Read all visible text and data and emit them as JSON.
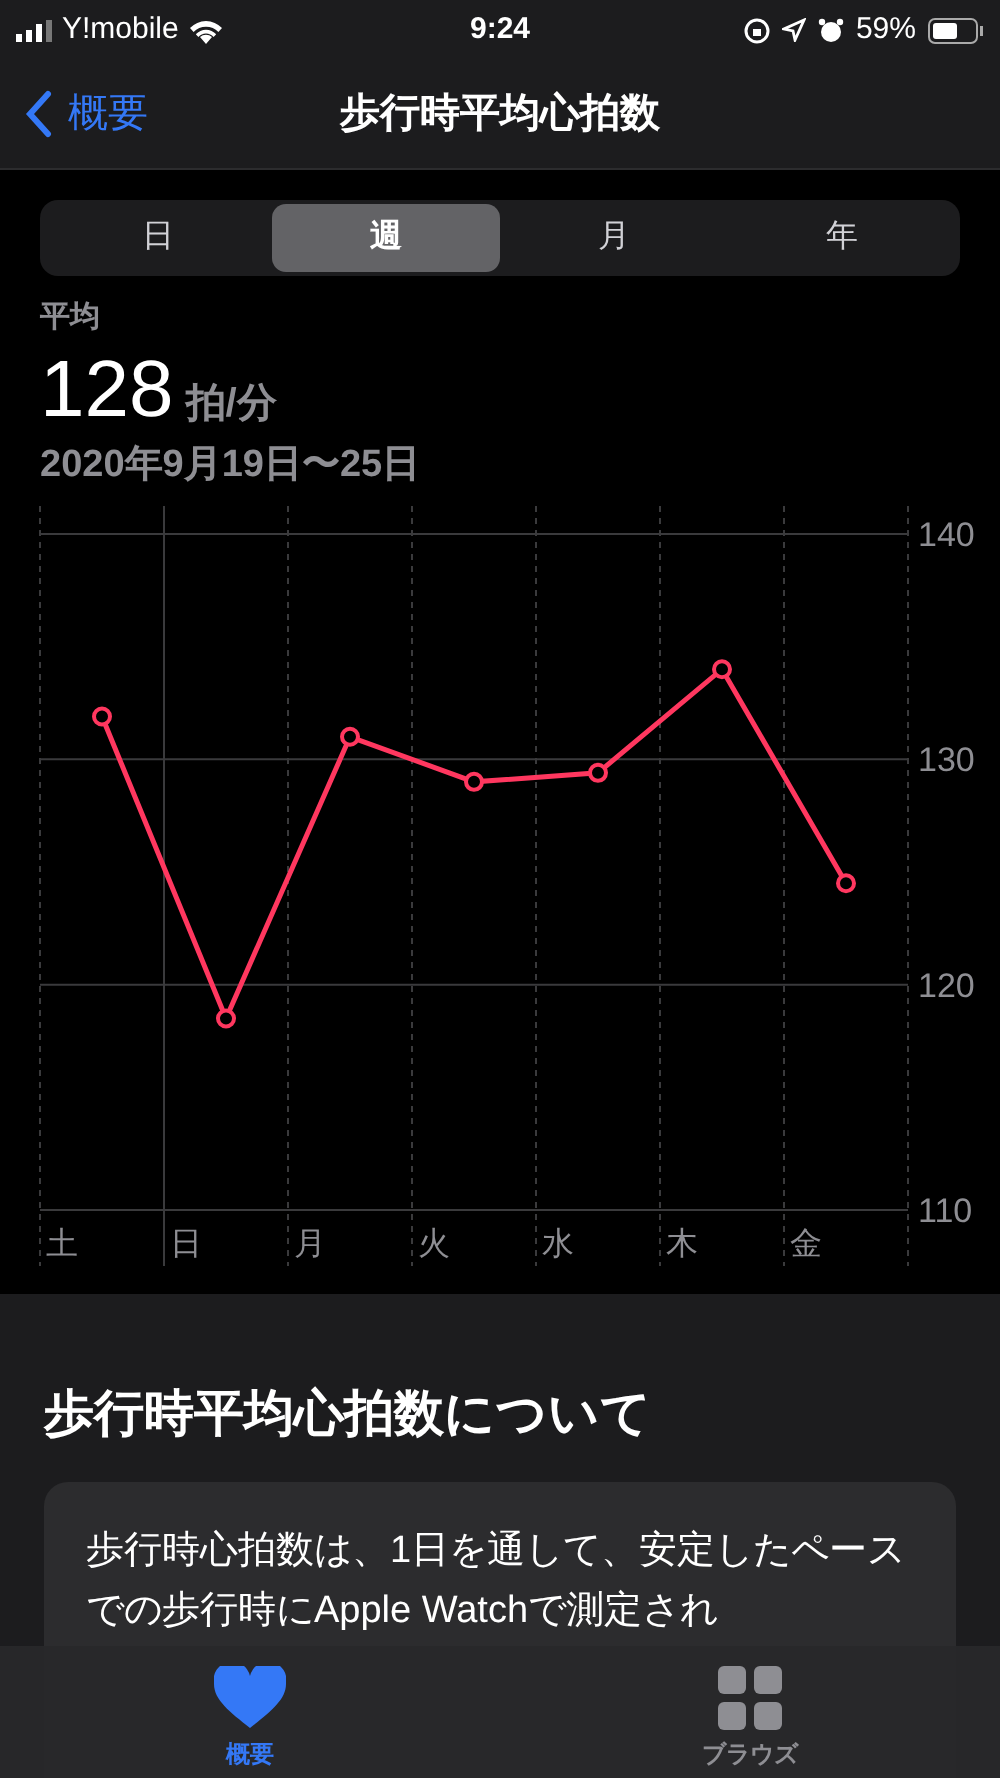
{
  "status_bar": {
    "carrier": "Y!mobile",
    "time": "9:24",
    "battery": "59%"
  },
  "nav": {
    "back": "概要",
    "title": "歩行時平均心拍数"
  },
  "segments": [
    {
      "label": "日",
      "selected": false
    },
    {
      "label": "週",
      "selected": true
    },
    {
      "label": "月",
      "selected": false
    },
    {
      "label": "年",
      "selected": false
    }
  ],
  "summary": {
    "label": "平均",
    "value": "128",
    "unit": "拍/分",
    "range": "2020年9月19日〜25日"
  },
  "chart_data": {
    "type": "line",
    "categories": [
      "土",
      "日",
      "月",
      "火",
      "水",
      "木",
      "金"
    ],
    "series": [
      {
        "color": "#ff375f",
        "marker": "circle",
        "values": [
          131.9,
          118.5,
          131,
          129,
          129.4,
          134,
          124.5
        ]
      }
    ],
    "ylim": [
      110,
      140
    ],
    "yticks": [
      110,
      120,
      130,
      140
    ]
  },
  "about": {
    "heading": "歩行時平均心拍数について",
    "text": "歩行時心拍数は、1日を通して、安定したペースでの歩行時にApple Watchで測定され"
  },
  "tab_bar": [
    {
      "label": "概要",
      "kind": "heart",
      "selected": true
    },
    {
      "label": "ブラウズ",
      "kind": "grid",
      "selected": false
    }
  ]
}
